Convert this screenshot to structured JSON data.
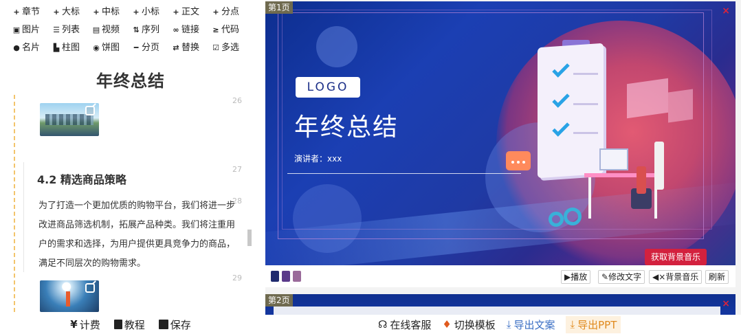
{
  "toolbar": {
    "rows": [
      [
        {
          "icon": "+",
          "label": "章节",
          "name": "chapter"
        },
        {
          "icon": "+",
          "label": "大标",
          "name": "big-title"
        },
        {
          "icon": "+",
          "label": "中标",
          "name": "mid-title"
        },
        {
          "icon": "+",
          "label": "小标",
          "name": "small-title"
        },
        {
          "icon": "+",
          "label": "正文",
          "name": "body-text"
        },
        {
          "icon": "+",
          "label": "分点",
          "name": "bullet-point"
        }
      ],
      [
        {
          "icon": "▣",
          "label": "图片",
          "name": "image"
        },
        {
          "icon": "☰",
          "label": "列表",
          "name": "list"
        },
        {
          "icon": "▤",
          "label": "视频",
          "name": "video"
        },
        {
          "icon": "⇅",
          "label": "序列",
          "name": "sequence"
        },
        {
          "icon": "∞",
          "label": "链接",
          "name": "link"
        },
        {
          "icon": "≥",
          "label": "代码",
          "name": "code"
        }
      ],
      [
        {
          "icon": "●",
          "label": "名片",
          "name": "card"
        },
        {
          "icon": "▙",
          "label": "柱图",
          "name": "bar-chart"
        },
        {
          "icon": "◉",
          "label": "饼图",
          "name": "pie-chart"
        },
        {
          "icon": "━",
          "label": "分页",
          "name": "page-break"
        },
        {
          "icon": "⇄",
          "label": "替换",
          "name": "replace"
        },
        {
          "icon": "☑",
          "label": "多选",
          "name": "multi-select"
        }
      ]
    ]
  },
  "doc": {
    "title": "年终总结",
    "line_numbers": [
      "26",
      "27",
      "28",
      "29"
    ],
    "section_heading": "4.2 精选商品策略",
    "section_paragraph": "为了打造一个更加优质的购物平台，我们将进一步改进商品筛选机制，拓展产品种类。我们将注重用户的需求和选择，为用户提供更具竞争力的商品，满足不同层次的购物需求。"
  },
  "bottom_left": {
    "billing": "计费",
    "tutorial": "教程",
    "save": "保存"
  },
  "slide1": {
    "badge": "第1页",
    "close": "×",
    "logo": "LOGO",
    "title": "年终总结",
    "presenter": "演讲者：xxx",
    "music_tag": "获取背景音乐"
  },
  "slide_bar": {
    "swatches": [
      "#1f2a6e",
      "#5a3a8a",
      "#9a6a9a"
    ],
    "play": "播放",
    "edit_text": "修改文字",
    "bg_music": "背景音乐",
    "refresh": "刷新"
  },
  "slide2": {
    "badge": "第2页",
    "close": "×"
  },
  "bottom_right": {
    "service": "在线客服",
    "switch_template": "切换模板",
    "export_doc": "导出文案",
    "export_ppt": "导出PPT"
  },
  "colors": {
    "accent_red": "#d3213e",
    "slide_blue": "#1b3fb3",
    "export_blue": "#3b6fc4",
    "export_orange": "#e08a1e"
  }
}
